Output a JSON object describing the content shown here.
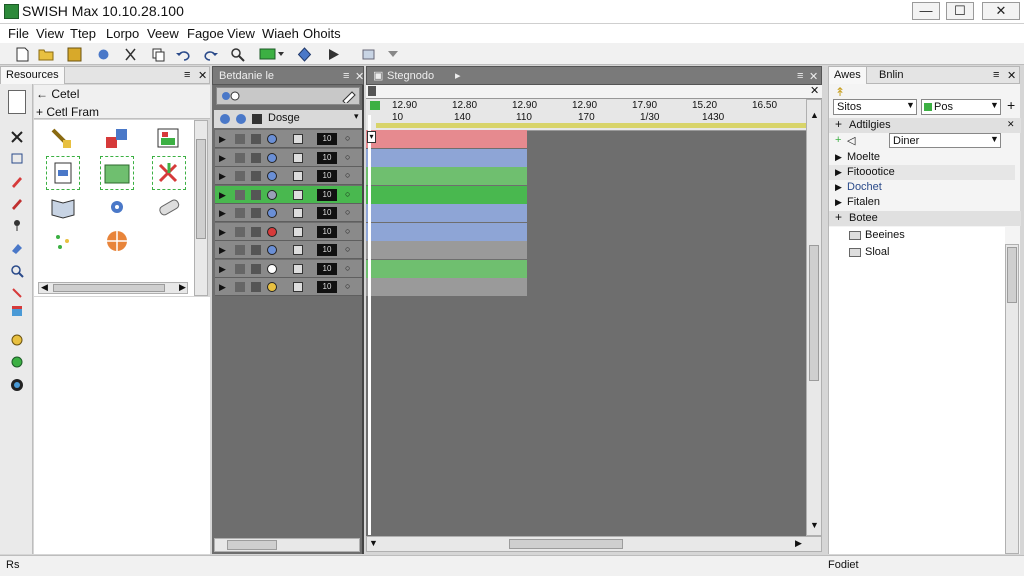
{
  "window": {
    "title": "SWISH Max 10.10.28.100",
    "minimize": "—",
    "maximize": "☐",
    "close": "✕"
  },
  "menu": [
    "File",
    "View",
    "Ttep",
    "Lorpo",
    "Veew",
    "Fagoe",
    "View",
    "Wiaeh",
    "Ohoits"
  ],
  "resources": {
    "tab": "Resources",
    "items": [
      {
        "label": "Cetel"
      },
      {
        "label": "Cetl Fram"
      }
    ]
  },
  "layers_panel": {
    "tab": "Betdanie le",
    "header_label": "Dosge"
  },
  "layers": [
    {
      "frame": "10",
      "color": "#6a8fd6"
    },
    {
      "frame": "10",
      "color": "#6a8fd6"
    },
    {
      "frame": "10",
      "color": "#6a8fd6"
    },
    {
      "frame": "10",
      "color": "#9aa0b8"
    },
    {
      "frame": "10",
      "color": "#6a8fd6"
    },
    {
      "frame": "10",
      "color": "#d63a3a"
    },
    {
      "frame": "10",
      "color": "#6a8fd6"
    },
    {
      "frame": "10",
      "color": "#ffffff"
    },
    {
      "frame": "10",
      "color": "#e8c040"
    }
  ],
  "timeline": {
    "tab": "Stegnodo",
    "ruler_times": [
      "12.90",
      "12.80",
      "12.90",
      "12.90",
      "17.90",
      "15.20",
      "16.50"
    ],
    "ruler_frames": [
      "10",
      "140",
      "110",
      "170",
      "1/30",
      "1430"
    ],
    "tracks": [
      "#e68a8f",
      "#8ea5d6",
      "#6fbf6f",
      "#49b84f",
      "#8ea5d6",
      "#8ea5d6",
      "#9a9a9a",
      "#6fbf6f",
      "#9a9a9a"
    ]
  },
  "props": {
    "tab1": "Awes",
    "tab2": "Bnlin",
    "select1": "Sitos",
    "select2": "Pos",
    "section1": "Adtilgies",
    "input_value": "Diner",
    "rows": [
      {
        "label": "Moelte"
      },
      {
        "label": "Fitoootice"
      },
      {
        "label": "Dochet"
      },
      {
        "label": "Fitalen"
      }
    ],
    "section2": "Botee",
    "folders": [
      {
        "label": "Beeines"
      },
      {
        "label": "Sloal"
      }
    ]
  },
  "status": {
    "left": "Rs",
    "right": "Fodiet"
  },
  "colors": {
    "accent_green": "#3cb043",
    "timeline_bg": "#6e6e6e"
  }
}
